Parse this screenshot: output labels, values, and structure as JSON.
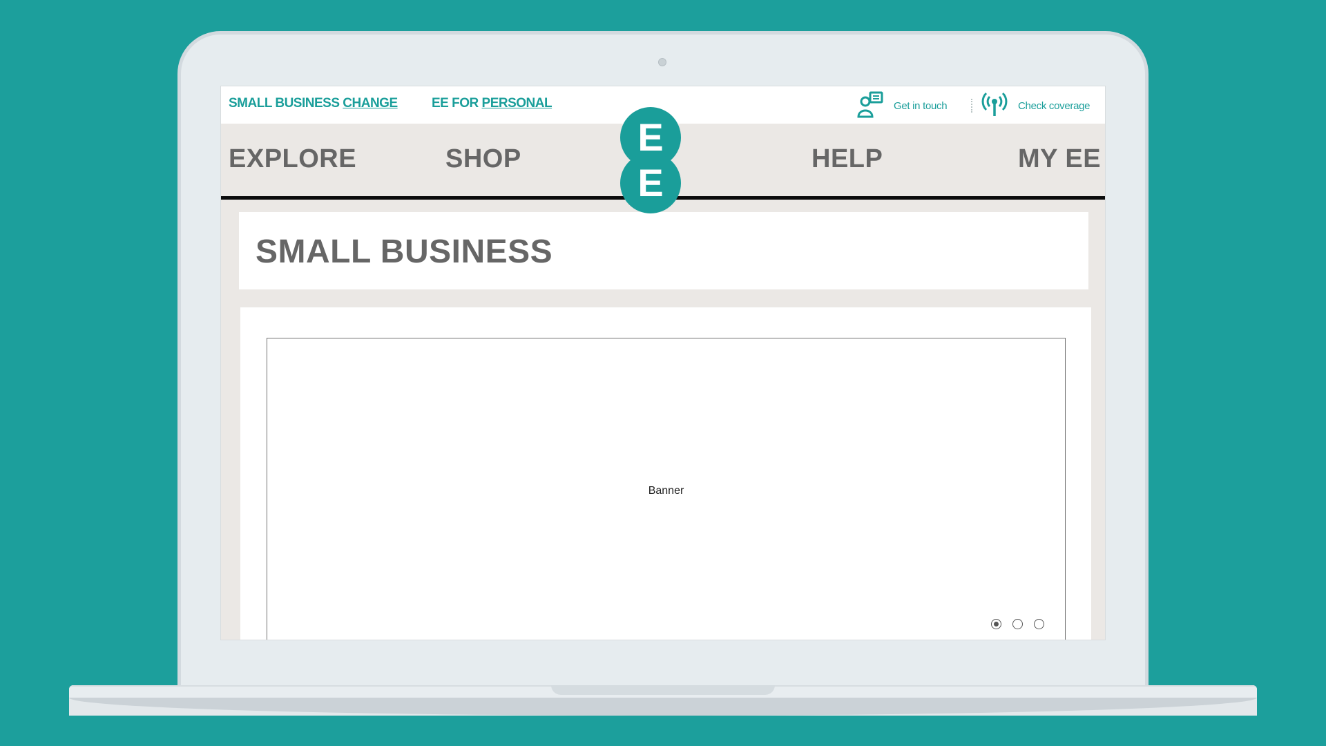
{
  "colors": {
    "background": "#1c9f9c",
    "brand_teal": "#1a9e9a",
    "nav_grey": "#666666",
    "nav_bg": "#ebe8e5"
  },
  "utility_bar": {
    "small_business_label": "SMALL BUSINESS",
    "change_link": "CHANGE",
    "ee_for_label": "EE FOR",
    "personal_link": "PERSONAL",
    "get_in_touch": "Get in touch",
    "check_coverage": "Check coverage"
  },
  "logo": {
    "top_letter": "E",
    "bottom_letter": "E"
  },
  "nav": {
    "items": [
      {
        "label": "EXPLORE"
      },
      {
        "label": "SHOP"
      },
      {
        "label": "HELP"
      },
      {
        "label": "MY EE"
      }
    ]
  },
  "page": {
    "title": "SMALL BUSINESS"
  },
  "banner": {
    "label": "Banner",
    "slides": 3,
    "active_slide": 1
  }
}
